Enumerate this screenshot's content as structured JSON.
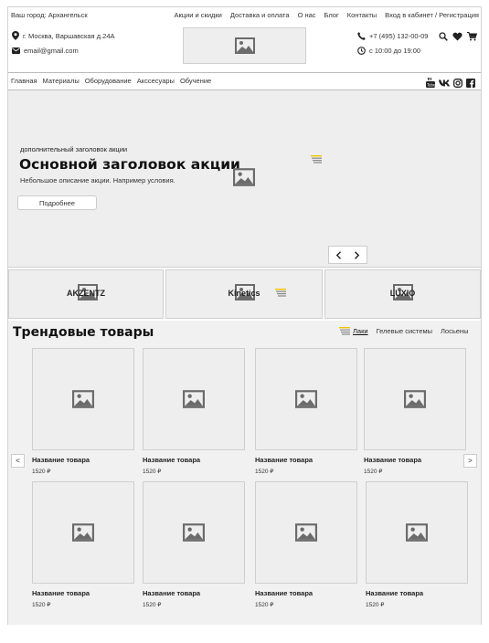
{
  "topbar": {
    "city": "Ваш город: Архангельск",
    "nav": [
      "Акции и скидки",
      "Доставка и оплата",
      "О нас",
      "Блог",
      "Контакты",
      "Вход в кабинет / Регистрация"
    ]
  },
  "header": {
    "address": "г. Москва, Варшавская д.24А",
    "email": "email@gmail.com",
    "phone": "+7 (495) 132-00-09",
    "hours": "с 10:00 до 19:00",
    "icons": [
      "search-icon",
      "heart-icon",
      "cart-icon"
    ]
  },
  "mainnav": [
    "Главная",
    "Материалы",
    "Оборудование",
    "Акссесуары",
    "Обучение"
  ],
  "socials": [
    "youtube-icon",
    "vk-icon",
    "instagram-icon",
    "facebook-icon"
  ],
  "hero": {
    "subtitle": "дополнительный заголовок акции",
    "title": "Основной заголовок акции",
    "description": "Небольшое описание акции. Например условия.",
    "button": "Подробнее"
  },
  "brands": [
    "AKZENTZ",
    "Kinetics",
    "LUXIO"
  ],
  "trending": {
    "title": "Трендовые товары",
    "filters": [
      "Лаки",
      "Гелевые системы",
      "Лосьены"
    ],
    "active_filter": "Лаки",
    "prev": "<",
    "next": ">",
    "products": [
      {
        "name": "Название товара",
        "price": "1520 ₽"
      },
      {
        "name": "Название товара",
        "price": "1520 ₽"
      },
      {
        "name": "Название товара",
        "price": "1520 ₽"
      },
      {
        "name": "Название товара",
        "price": "1520 ₽"
      },
      {
        "name": "Название товара",
        "price": "1520 ₽"
      },
      {
        "name": "Название товара",
        "price": "1520 ₽"
      },
      {
        "name": "Название товара",
        "price": "1520 ₽"
      },
      {
        "name": "Название товара",
        "price": "1520 ₽"
      }
    ]
  },
  "colors": {
    "placeholder_bg": "#eeeeee",
    "border": "#cfcfcf",
    "accent": "#f2c200"
  }
}
